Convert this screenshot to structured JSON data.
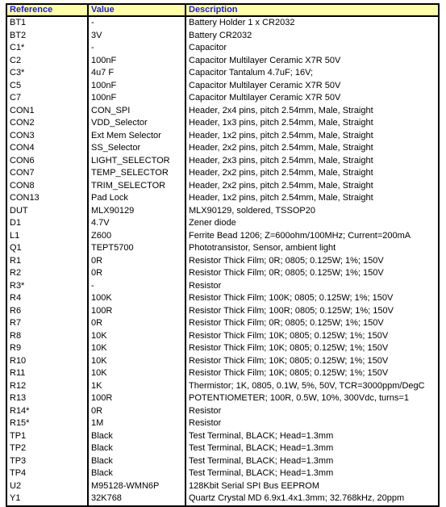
{
  "table": {
    "headers": {
      "reference": "Reference",
      "value": "Value",
      "description": "Description"
    },
    "header_colors": {
      "background": "#ffffa8",
      "text": "#1a1aff"
    },
    "rows": [
      {
        "reference": "BT1",
        "value": "-",
        "description": "Battery Holder 1 x CR2032"
      },
      {
        "reference": "BT2",
        "value": "3V",
        "description": "Battery CR2032"
      },
      {
        "reference": "C1*",
        "value": "-",
        "description": "Capacitor"
      },
      {
        "reference": "C2",
        "value": "100nF",
        "description": "Capacitor Multilayer Ceramic X7R 50V"
      },
      {
        "reference": "C3*",
        "value": "4u7 F",
        "description": "Capacitor Tantalum 4.7uF; 16V;"
      },
      {
        "reference": "C5",
        "value": "100nF",
        "description": "Capacitor Multilayer Ceramic X7R 50V"
      },
      {
        "reference": "C7",
        "value": "100nF",
        "description": "Capacitor Multilayer Ceramic X7R 50V"
      },
      {
        "reference": "CON1",
        "value": "CON_SPI",
        "description": "Header, 2x4 pins, pitch 2.54mm, Male, Straight"
      },
      {
        "reference": "CON2",
        "value": "VDD_Selector",
        "description": "Header, 1x3 pins, pitch 2.54mm, Male, Straight"
      },
      {
        "reference": "CON3",
        "value": "Ext Mem Selector",
        "description": "Header, 1x2 pins, pitch 2.54mm, Male, Straight"
      },
      {
        "reference": "CON4",
        "value": "SS_Selector",
        "description": "Header, 2x2 pins, pitch 2.54mm, Male, Straight"
      },
      {
        "reference": "CON6",
        "value": "LIGHT_SELECTOR",
        "description": "Header, 2x3 pins, pitch 2.54mm, Male, Straight"
      },
      {
        "reference": "CON7",
        "value": "TEMP_SELECTOR",
        "description": "Header, 2x2 pins, pitch 2.54mm, Male, Straight"
      },
      {
        "reference": "CON8",
        "value": "TRIM_SELECTOR",
        "description": "Header, 2x2 pins, pitch 2.54mm, Male, Straight"
      },
      {
        "reference": "CON13",
        "value": "Pad Lock",
        "description": "Header, 1x2 pins, pitch 2.54mm, Male, Straight"
      },
      {
        "reference": "DUT",
        "value": "MLX90129",
        "description": "MLX90129, soldered, TSSOP20"
      },
      {
        "reference": "D1",
        "value": "4.7V",
        "description": "Zener diode"
      },
      {
        "reference": " L1",
        "value": " Z600",
        "description": " Ferrite Bead 1206; Z=600ohm/100MHz; Current=200mA"
      },
      {
        "reference": "Q1",
        "value": "TEPT5700",
        "description": "Phototransistor, Sensor, ambient light"
      },
      {
        "reference": "R1",
        "value": "0R",
        "description": "Resistor Thick Film; 0R; 0805; 0.125W; 1%; 150V"
      },
      {
        "reference": "R2",
        "value": "0R",
        "description": "Resistor Thick Film; 0R; 0805; 0.125W; 1%; 150V"
      },
      {
        "reference": "R3*",
        "value": "-",
        "description": "Resistor"
      },
      {
        "reference": "R4",
        "value": "100K",
        "description": "Resistor Thick Film; 100K; 0805; 0.125W; 1%; 150V"
      },
      {
        "reference": "R6",
        "value": "100R",
        "description": "Resistor Thick Film; 100R; 0805; 0.125W; 1%; 150V"
      },
      {
        "reference": "R7",
        "value": "0R",
        "description": "Resistor Thick Film; 0R; 0805; 0.125W; 1%; 150V"
      },
      {
        "reference": "R8",
        "value": "10K",
        "description": "Resistor Thick Film; 10K; 0805; 0.125W; 1%; 150V"
      },
      {
        "reference": "R9",
        "value": "10K",
        "description": "Resistor Thick Film; 10K; 0805; 0.125W; 1%; 150V"
      },
      {
        "reference": "R10",
        "value": "10K",
        "description": "Resistor Thick Film; 10K; 0805; 0.125W; 1%; 150V"
      },
      {
        "reference": "R11",
        "value": "10K",
        "description": "Resistor Thick Film; 10K; 0805; 0.125W; 1%; 150V"
      },
      {
        "reference": "R12",
        "value": "1K",
        "description": "Thermistor; 1K, 0805, 0.1W, 5%, 50V, TCR=3000ppm/DegC"
      },
      {
        "reference": "R13",
        "value": "100R",
        "description": "POTENTIOMETER; 100R, 0.5W, 10%, 300Vdc, turns=1"
      },
      {
        "reference": "R14*",
        "value": "0R",
        "description": "Resistor"
      },
      {
        "reference": "R15*",
        "value": "1M",
        "description": "Resistor"
      },
      {
        "reference": "TP1",
        "value": "Black",
        "description": "Test Terminal, BLACK; Head=1.3mm"
      },
      {
        "reference": "TP2",
        "value": "Black",
        "description": "Test Terminal, BLACK; Head=1.3mm"
      },
      {
        "reference": "TP3",
        "value": "Black",
        "description": "Test Terminal, BLACK; Head=1.3mm"
      },
      {
        "reference": "TP4",
        "value": "Black",
        "description": "Test Terminal, BLACK; Head=1.3mm"
      },
      {
        "reference": "U2",
        "value": "M95128-WMN6P",
        "description": "128Kbit Serial SPI Bus EEPROM"
      },
      {
        "reference": "Y1",
        "value": "32K768",
        "description": "Quartz Crystal MD 6.9x1.4x1.3mm; 32.768kHz, 20ppm"
      }
    ]
  }
}
